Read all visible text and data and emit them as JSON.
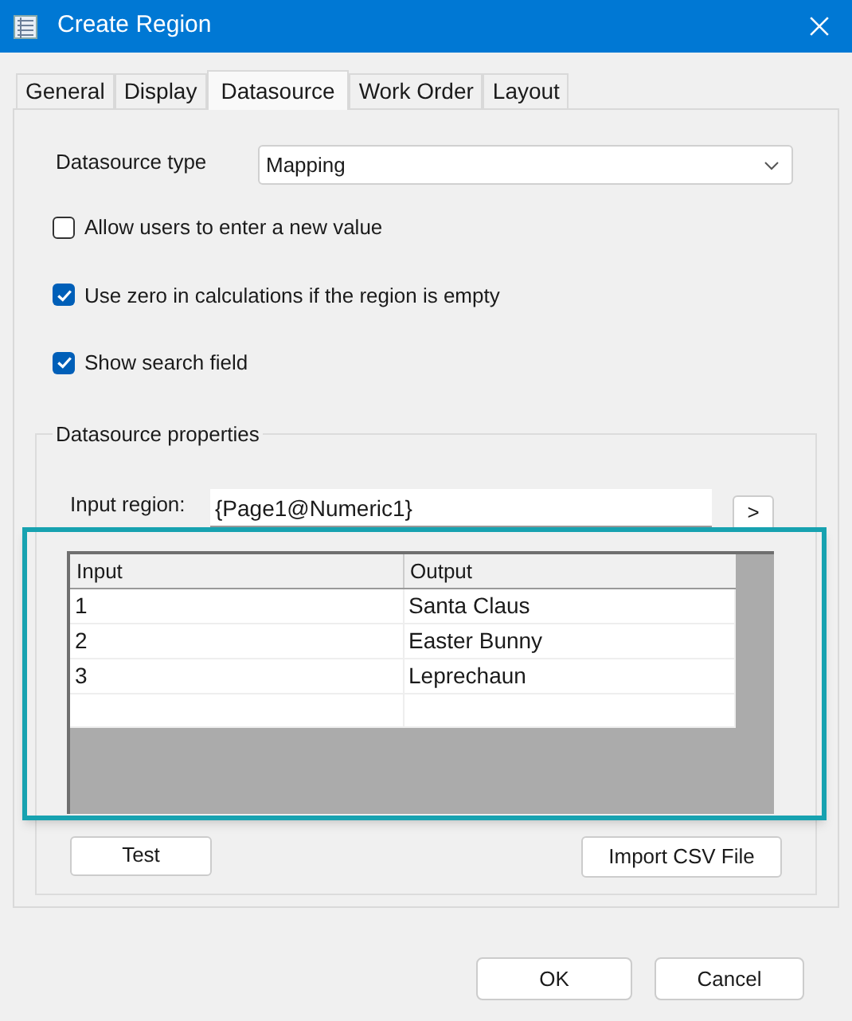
{
  "window": {
    "title": "Create Region"
  },
  "tabs": [
    {
      "label": "General",
      "selected": false
    },
    {
      "label": "Display",
      "selected": false
    },
    {
      "label": "Datasource",
      "selected": true
    },
    {
      "label": "Work Order",
      "selected": false
    },
    {
      "label": "Layout",
      "selected": false
    }
  ],
  "datasource_type": {
    "label": "Datasource type",
    "value": "Mapping"
  },
  "options": [
    {
      "label": "Allow users to enter a new value",
      "checked": false
    },
    {
      "label": "Use zero in calculations if the region is empty",
      "checked": true
    },
    {
      "label": "Show search field",
      "checked": true
    }
  ],
  "properties": {
    "title": "Datasource properties",
    "input_region": {
      "label": "Input region:",
      "value": "{Page1@Numeric1}",
      "button": ">"
    },
    "table": {
      "columns": [
        "Input",
        "Output"
      ],
      "rows": [
        [
          "1",
          "Santa Claus"
        ],
        [
          "2",
          "Easter Bunny"
        ],
        [
          "3",
          "Leprechaun"
        ]
      ]
    },
    "buttons": [
      "Test",
      "Import CSV File"
    ]
  },
  "footer_buttons": [
    "OK",
    "Cancel"
  ]
}
